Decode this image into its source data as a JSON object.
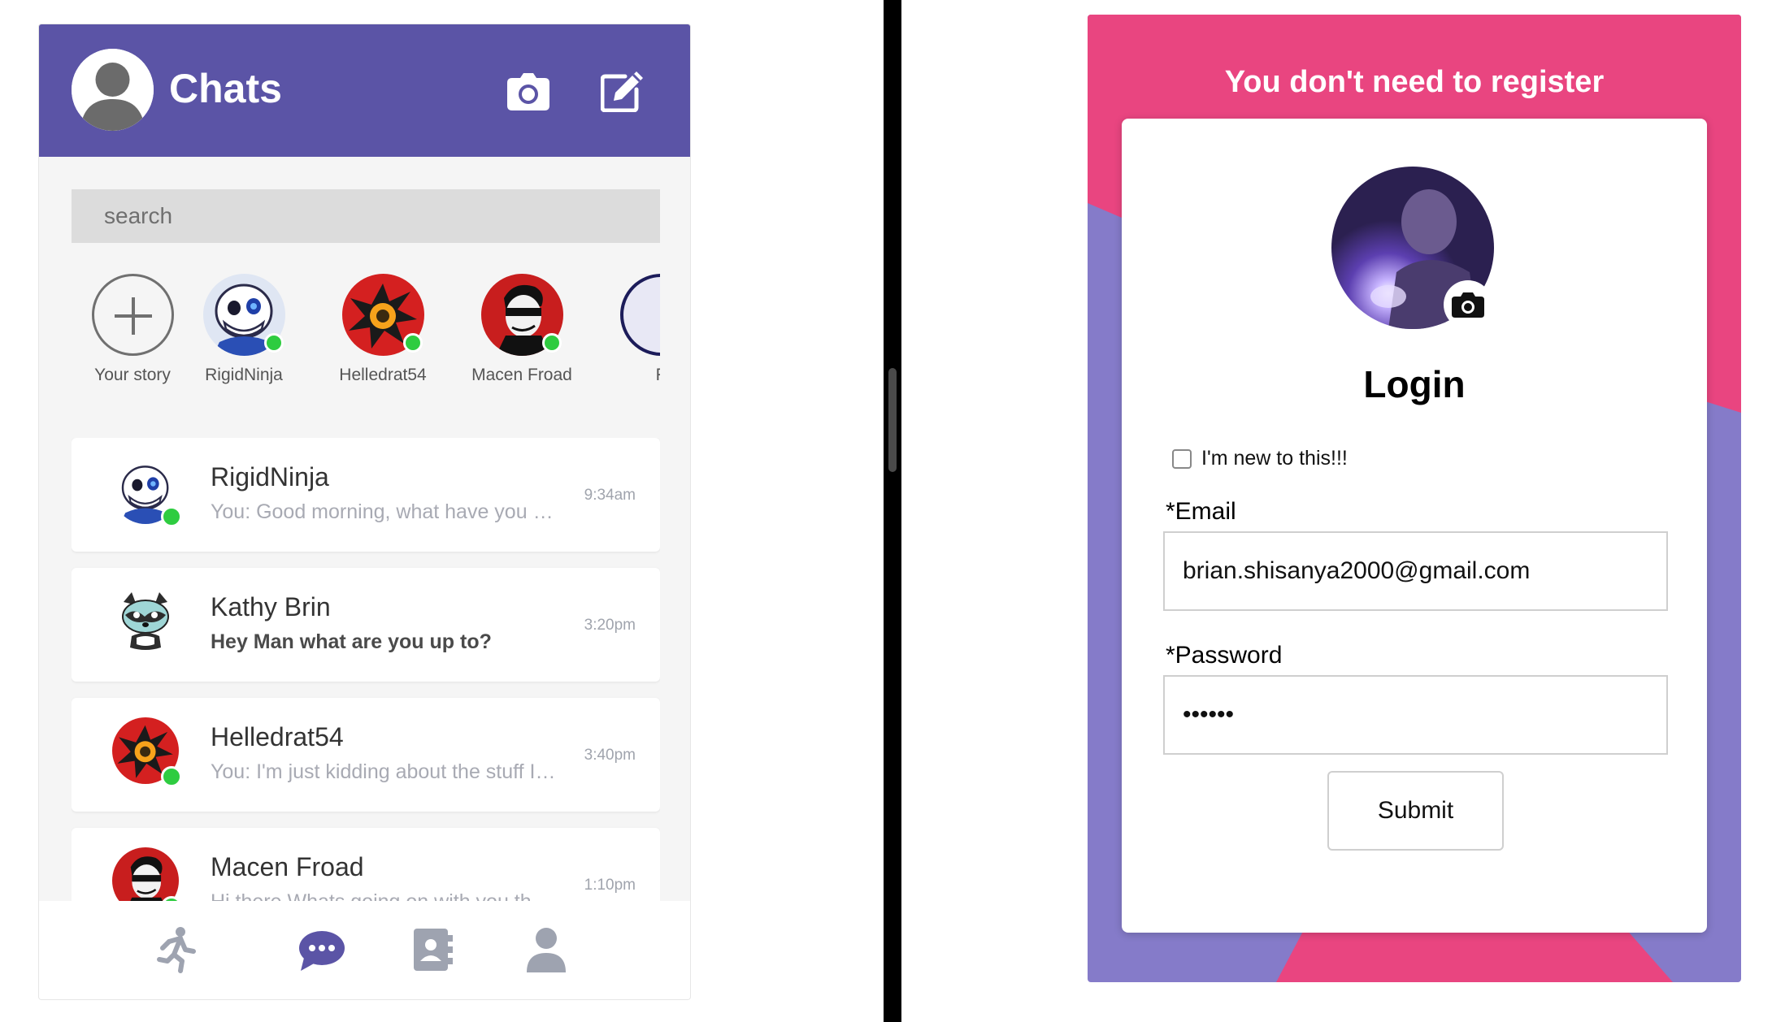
{
  "chat_app": {
    "header": {
      "title": "Chats",
      "profile_avatar_icon": "user-silhouette-icon",
      "camera_icon": "camera-icon",
      "compose_icon": "compose-icon",
      "bg_color": "#5b54a6"
    },
    "search": {
      "placeholder": "search"
    },
    "stories": [
      {
        "label": "Your story",
        "type": "add"
      },
      {
        "label": "RigidNinja",
        "online": true
      },
      {
        "label": "Helledrat54",
        "online": true
      },
      {
        "label": "Macen Froad",
        "online": true
      },
      {
        "label": "F",
        "online": false
      }
    ],
    "conversations": [
      {
        "name": "RigidNinja",
        "preview": "You: Good morning, what have you been up to?",
        "time": "9:34am",
        "online": true,
        "unread": false
      },
      {
        "name": "Kathy Brin",
        "preview": "Hey Man what are you up to?",
        "time": "3:20pm",
        "online": false,
        "unread": true
      },
      {
        "name": "Helledrat54",
        "preview": "You: I'm just kidding about the stuff I said",
        "time": "3:40pm",
        "online": true,
        "unread": false
      },
      {
        "name": "Macen Froad",
        "preview": "Hi there Whats going on with you these days",
        "time": "1:10pm",
        "online": true,
        "unread": false
      }
    ],
    "bottom_nav": [
      {
        "icon": "running-person-icon",
        "active": false
      },
      {
        "icon": "chat-bubble-icon",
        "active": true
      },
      {
        "icon": "contacts-book-icon",
        "active": false
      },
      {
        "icon": "user-profile-icon",
        "active": false
      }
    ],
    "online_color": "#2ecc40"
  },
  "login": {
    "banner": "You don't need to register",
    "title": "Login",
    "new_user_label": "I'm new to this!!!",
    "new_user_checked": false,
    "email_label": "*Email",
    "email_value": "brian.shisanya2000@gmail.com",
    "password_label": "*Password",
    "password_value": "••••••",
    "submit_label": "Submit",
    "profile_camera_icon": "camera-icon",
    "colors": {
      "pink": "#e94580",
      "purple": "#857bc9"
    }
  }
}
